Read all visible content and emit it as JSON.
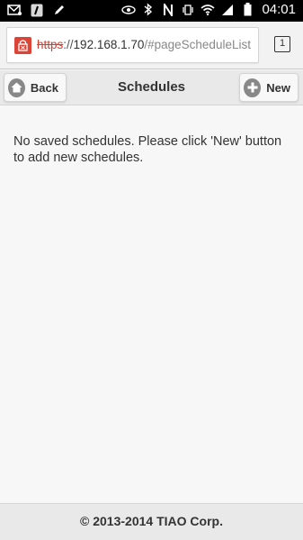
{
  "status_bar": {
    "time": "04:01",
    "left_icons": [
      "mail-icon",
      "tiao-app-icon",
      "pencil-icon"
    ],
    "right_icons": [
      "eye-icon",
      "bluetooth-icon",
      "nfc-icon",
      "vibrate-icon",
      "wifi-icon",
      "signal-icon",
      "battery-icon"
    ]
  },
  "address_bar": {
    "url_scheme": "https",
    "url_separator": "://",
    "url_host": "192.168.1.70",
    "url_path": "/#pageScheduleList",
    "tab_count": "1",
    "lock_color": "#db4437"
  },
  "header": {
    "back_label": "Back",
    "title": "Schedules",
    "new_label": "New"
  },
  "content": {
    "message": "No saved schedules. Please click 'New' button to add new schedules."
  },
  "footer": {
    "copyright": "© 2013-2014 TIAO Corp."
  }
}
